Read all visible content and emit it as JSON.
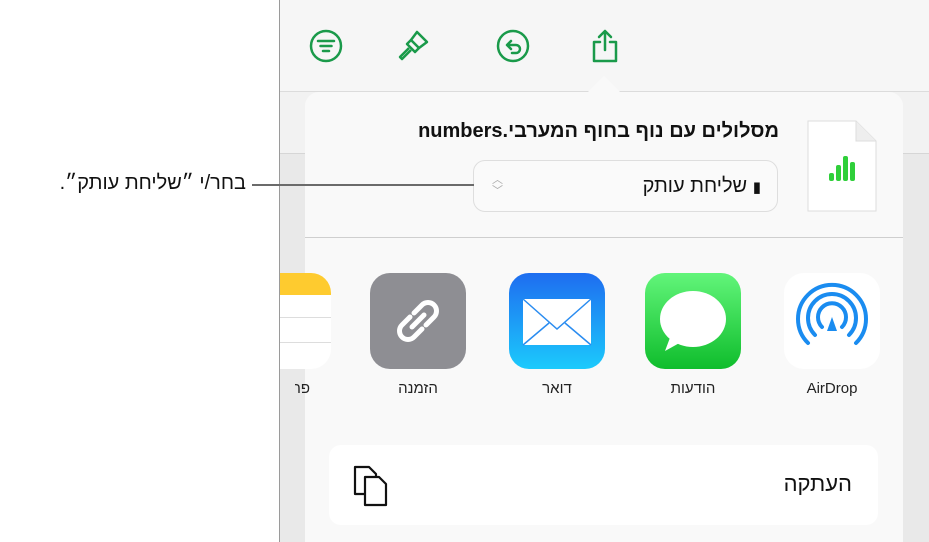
{
  "callout": {
    "text": "בחר/י ״שליחת עותק״."
  },
  "toolbar": {
    "icons": [
      "organize-icon",
      "format-brush-icon",
      "undo-icon",
      "share-icon"
    ],
    "accent": "#1a9a4a"
  },
  "share_sheet": {
    "title": "מסלולים עם נוף בחוף המערבי.numbers",
    "send_option": "שליחת עותק",
    "apps": [
      {
        "label": "AirDrop"
      },
      {
        "label": "הודעות"
      },
      {
        "label": "דואר"
      },
      {
        "label": "הזמנה"
      },
      {
        "label": "פתקים"
      }
    ],
    "copy_action": "העתקה"
  }
}
